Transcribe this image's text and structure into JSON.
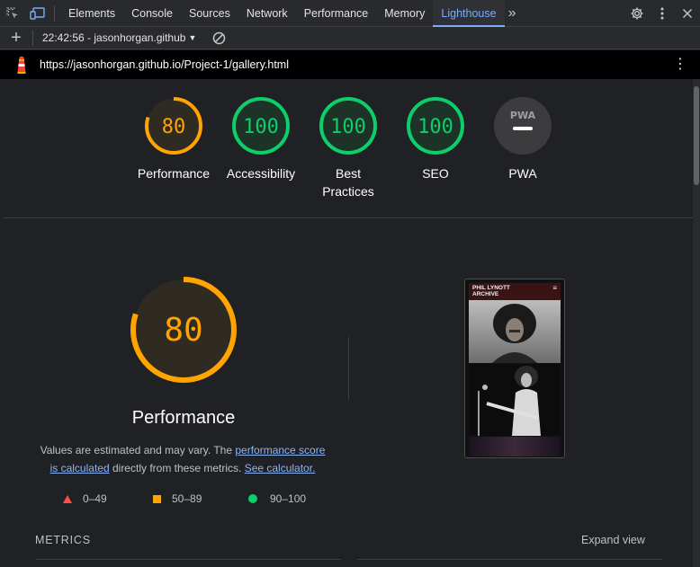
{
  "devtools": {
    "tabs": [
      {
        "label": "Elements"
      },
      {
        "label": "Console"
      },
      {
        "label": "Sources"
      },
      {
        "label": "Network"
      },
      {
        "label": "Performance"
      },
      {
        "label": "Memory"
      },
      {
        "label": "Lighthouse"
      }
    ],
    "active_tab": "Lighthouse",
    "more_tabs_label": "»",
    "accent_color": "#7cacf8"
  },
  "toolbar": {
    "report_select": "22:42:56 - jasonhorgan.github",
    "add_icon": "plus-icon",
    "clear_icon": "clear-icon"
  },
  "url_bar": {
    "url": "https://jasonhorgan.github.io/Project-1/gallery.html"
  },
  "scores": [
    {
      "label": "Performance",
      "score": "80",
      "value": 80,
      "color": "#ffa400"
    },
    {
      "label": "Accessibility",
      "score": "100",
      "value": 100,
      "color": "#0cce6b"
    },
    {
      "label": "Best Practices",
      "score": "100",
      "value": 100,
      "color": "#0cce6b"
    },
    {
      "label": "SEO",
      "score": "100",
      "value": 100,
      "color": "#0cce6b"
    },
    {
      "label": "PWA",
      "score": "PWA",
      "value": null,
      "color": "#9aa0a6"
    }
  ],
  "performance": {
    "score": "80",
    "value": 80,
    "title": "Performance",
    "desc_before": "Values are estimated and may vary. The ",
    "link_score": "performance score is calculated",
    "desc_middle": " directly from these metrics. ",
    "link_calculator": "See calculator."
  },
  "legend": [
    {
      "range": "0–49",
      "color": "#ff4e42",
      "shape": "triangle"
    },
    {
      "range": "50–89",
      "color": "#ffa400",
      "shape": "square"
    },
    {
      "range": "90–100",
      "color": "#0cce6b",
      "shape": "circle"
    }
  ],
  "metrics": {
    "label": "METRICS",
    "expand_label": "Expand view"
  },
  "screenshot": {
    "site_title": "PHIL LYNOTT ARCHIVE",
    "menu_icon": "hamburger-icon"
  }
}
